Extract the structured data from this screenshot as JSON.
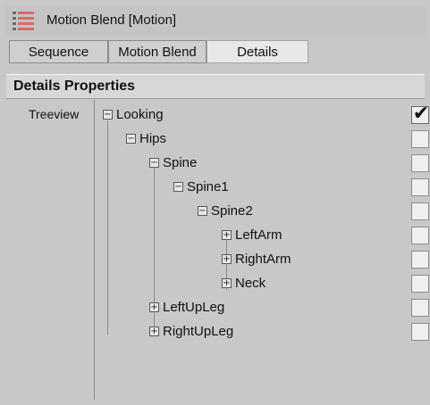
{
  "window": {
    "title": "Motion Blend [Motion]",
    "icon": "motion-blend-icon"
  },
  "tabs": [
    {
      "label": "Sequence",
      "active": false
    },
    {
      "label": "Motion Blend",
      "active": false
    },
    {
      "label": "Details",
      "active": true
    }
  ],
  "section": {
    "title": "Details Properties"
  },
  "property": {
    "label": "Treeview"
  },
  "tree": [
    {
      "label": "Looking",
      "state": "minus",
      "checked": true
    },
    {
      "label": "Hips",
      "state": "minus",
      "checked": false
    },
    {
      "label": "Spine",
      "state": "minus",
      "checked": false
    },
    {
      "label": "Spine1",
      "state": "minus",
      "checked": false
    },
    {
      "label": "Spine2",
      "state": "minus",
      "checked": false
    },
    {
      "label": "LeftArm",
      "state": "plus",
      "checked": false
    },
    {
      "label": "RightArm",
      "state": "plus",
      "checked": false
    },
    {
      "label": "Neck",
      "state": "plus",
      "checked": false
    },
    {
      "label": "LeftUpLeg",
      "state": "plus",
      "checked": false
    },
    {
      "label": "RightUpLeg",
      "state": "plus",
      "checked": false
    }
  ],
  "colors": {
    "background": "#c8c8c8",
    "header": "#d7d7d7",
    "check_fill": "#efefef",
    "active_tab": "#e8e8e8"
  }
}
